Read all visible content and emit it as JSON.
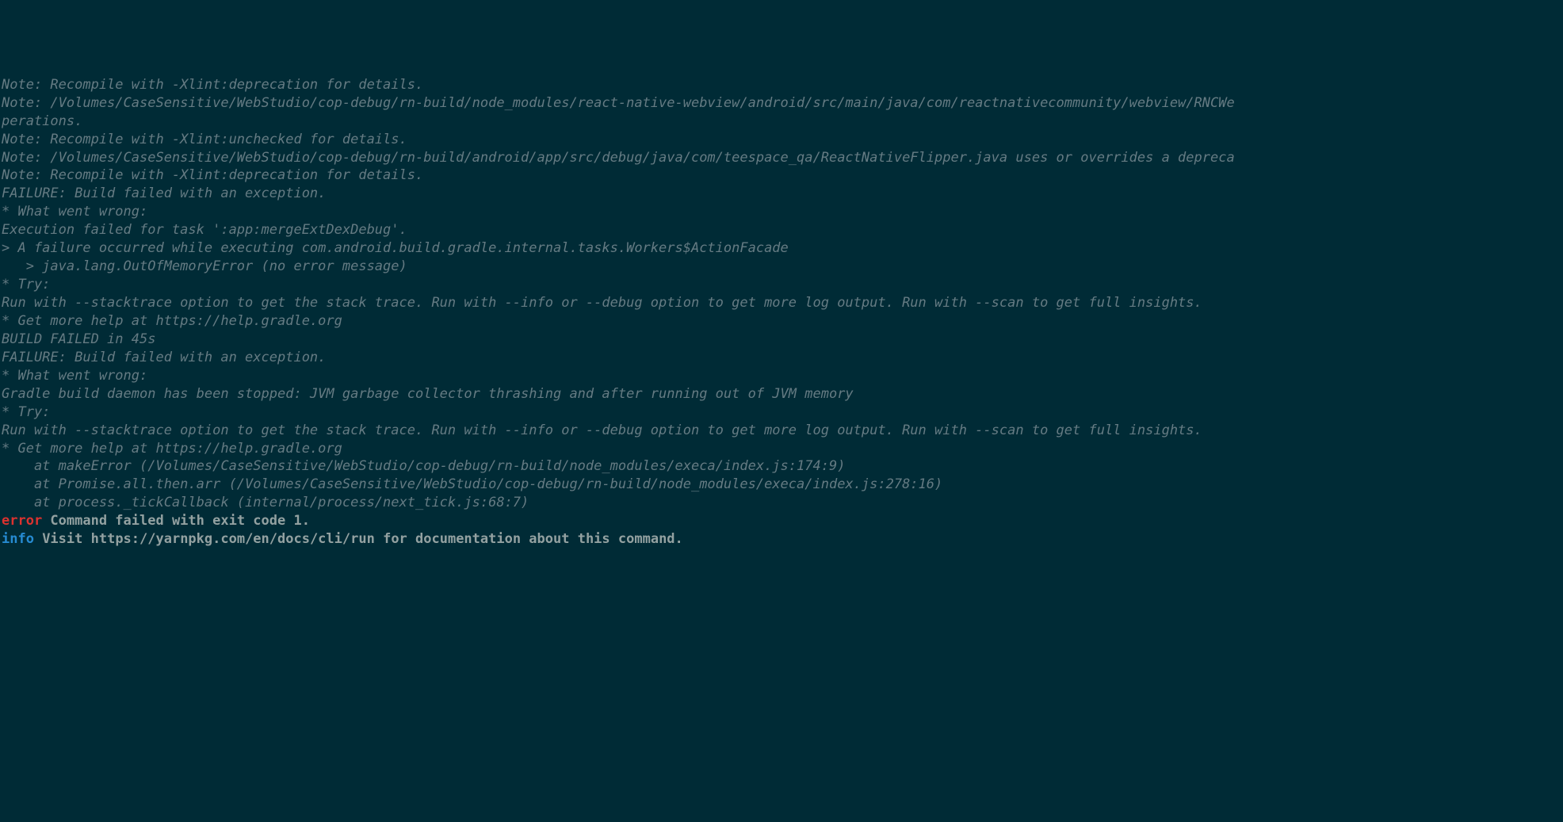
{
  "lines": {
    "l0": "Note: Recompile with -Xlint:deprecation for details.",
    "l1": "Note: /Volumes/CaseSensitive/WebStudio/cop-debug/rn-build/node_modules/react-native-webview/android/src/main/java/com/reactnativecommunity/webview/RNCWe",
    "l2": "perations.",
    "l3": "Note: Recompile with -Xlint:unchecked for details.",
    "l4": "Note: /Volumes/CaseSensitive/WebStudio/cop-debug/rn-build/android/app/src/debug/java/com/teespace_qa/ReactNativeFlipper.java uses or overrides a depreca",
    "l5": "Note: Recompile with -Xlint:deprecation for details.",
    "l6": "",
    "l7": "FAILURE: Build failed with an exception.",
    "l8": "",
    "l9": "* What went wrong:",
    "l10": "Execution failed for task ':app:mergeExtDexDebug'.",
    "l11": "> A failure occurred while executing com.android.build.gradle.internal.tasks.Workers$ActionFacade",
    "l12": "   > java.lang.OutOfMemoryError (no error message)",
    "l13": "",
    "l14": "* Try:",
    "l15": "Run with --stacktrace option to get the stack trace. Run with --info or --debug option to get more log output. Run with --scan to get full insights.",
    "l16": "",
    "l17": "* Get more help at https://help.gradle.org",
    "l18": "",
    "l19": "BUILD FAILED in 45s",
    "l20": "",
    "l21": "FAILURE: Build failed with an exception.",
    "l22": "",
    "l23": "* What went wrong:",
    "l24": "Gradle build daemon has been stopped: JVM garbage collector thrashing and after running out of JVM memory",
    "l25": "",
    "l26": "* Try:",
    "l27": "Run with --stacktrace option to get the stack trace. Run with --info or --debug option to get more log output. Run with --scan to get full insights.",
    "l28": "",
    "l29": "* Get more help at https://help.gradle.org",
    "l30": "",
    "l31": "    at makeError (/Volumes/CaseSensitive/WebStudio/cop-debug/rn-build/node_modules/execa/index.js:174:9)",
    "l32": "    at Promise.all.then.arr (/Volumes/CaseSensitive/WebStudio/cop-debug/rn-build/node_modules/execa/index.js:278:16)",
    "l33": "    at process._tickCallback (internal/process/next_tick.js:68:7)",
    "err_prefix": "error",
    "err_msg": " Command failed with exit code 1.",
    "info_prefix": "info",
    "info_msg1": " Visit ",
    "info_url": "https://yarnpkg.com/en/docs/cli/run",
    "info_msg2": " for documentation about this command."
  }
}
